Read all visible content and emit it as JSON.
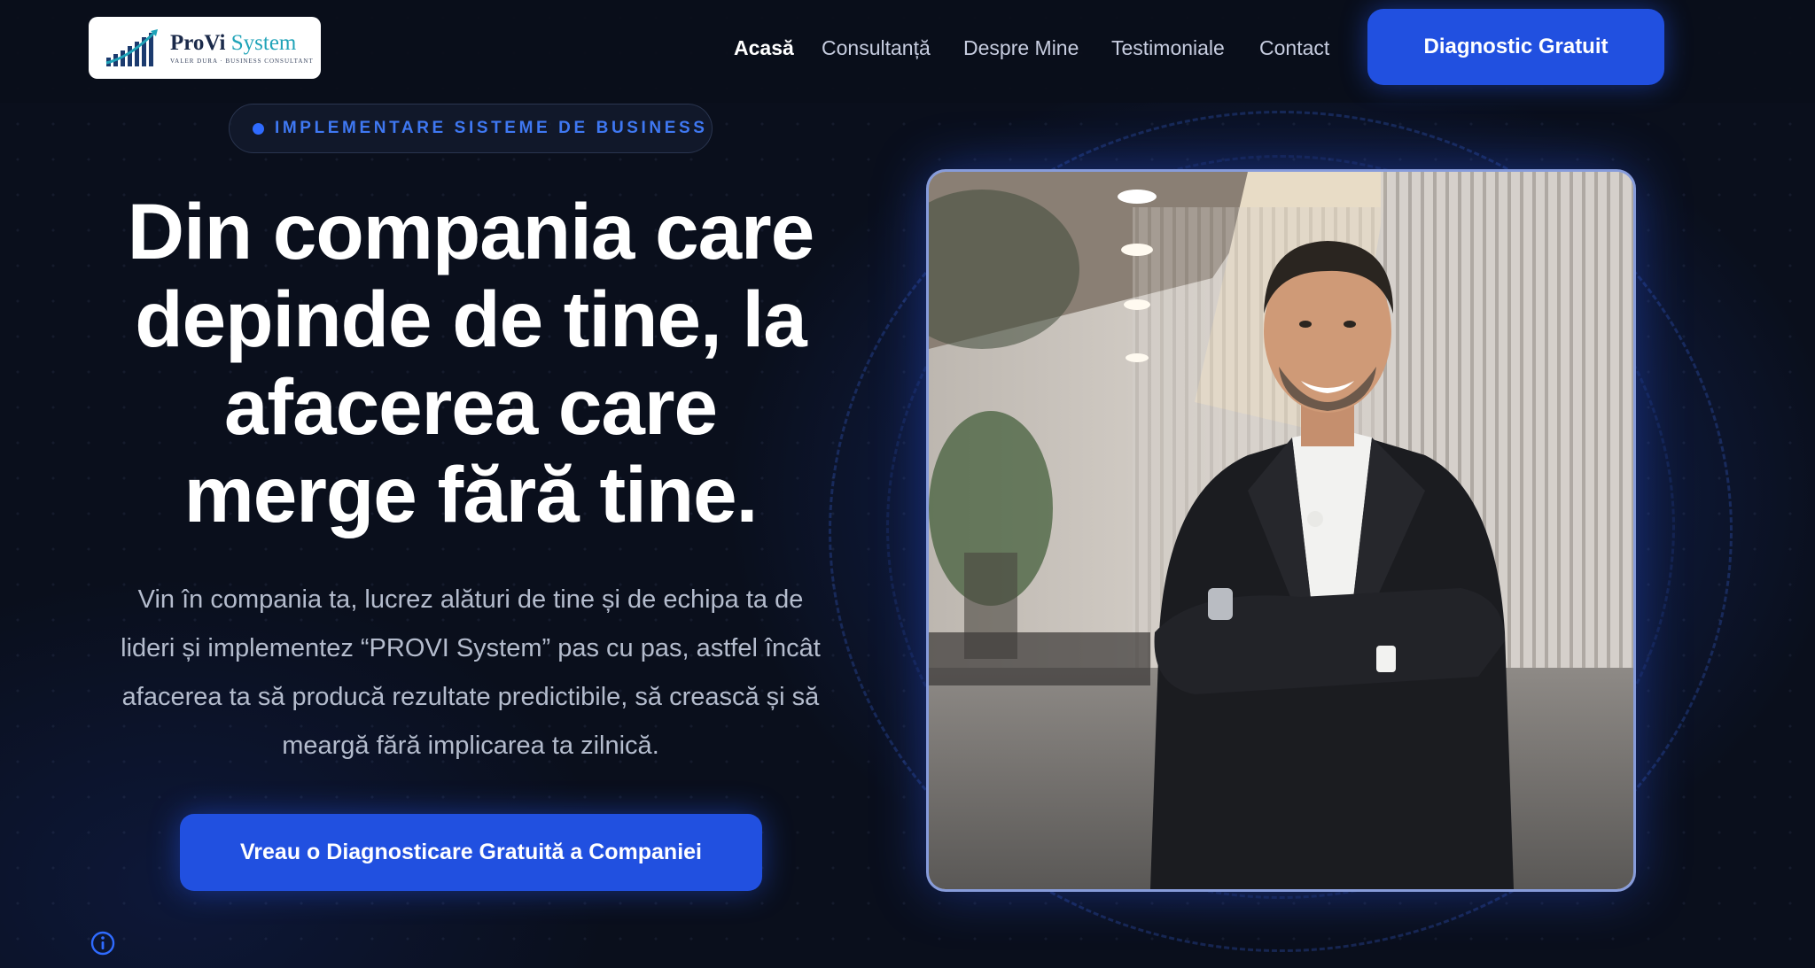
{
  "header": {
    "logo": {
      "title_main": "ProVi",
      "title_accent": "System",
      "subtitle": "VALER DURA · BUSINESS CONSULTANT"
    },
    "nav": [
      {
        "label": "Acasă",
        "active": true
      },
      {
        "label": "Consultanță",
        "active": false
      },
      {
        "label": "Despre Mine",
        "active": false
      },
      {
        "label": "Testimoniale",
        "active": false
      },
      {
        "label": "Contact",
        "active": false
      }
    ],
    "cta_label": "Diagnostic Gratuit"
  },
  "hero": {
    "badge": "IMPLEMENTARE SISTEME DE BUSINESS",
    "headline_lines": [
      "Din compania care",
      "depinde de tine, la",
      "afacerea care",
      "merge fără tine."
    ],
    "lead_lines": [
      "Vin în compania ta, lucrez alături de tine și de echipa ta de",
      "lideri și implementez “PROVI System” pas cu pas, astfel încât",
      "afacerea ta să producă rezultate predictibile, să crească și să",
      "meargă fără implicarea ta zilnică."
    ],
    "cta_label": "Vreau o Diagnosticare Gratuită a Companiei"
  },
  "colors": {
    "background": "#0a0f1c",
    "accent": "#2150e0",
    "badge_text": "#3f78f2",
    "logo_accent": "#1fa3b8"
  },
  "icons": {
    "info": "info-icon",
    "logo": "bar-chart-logo-icon"
  }
}
